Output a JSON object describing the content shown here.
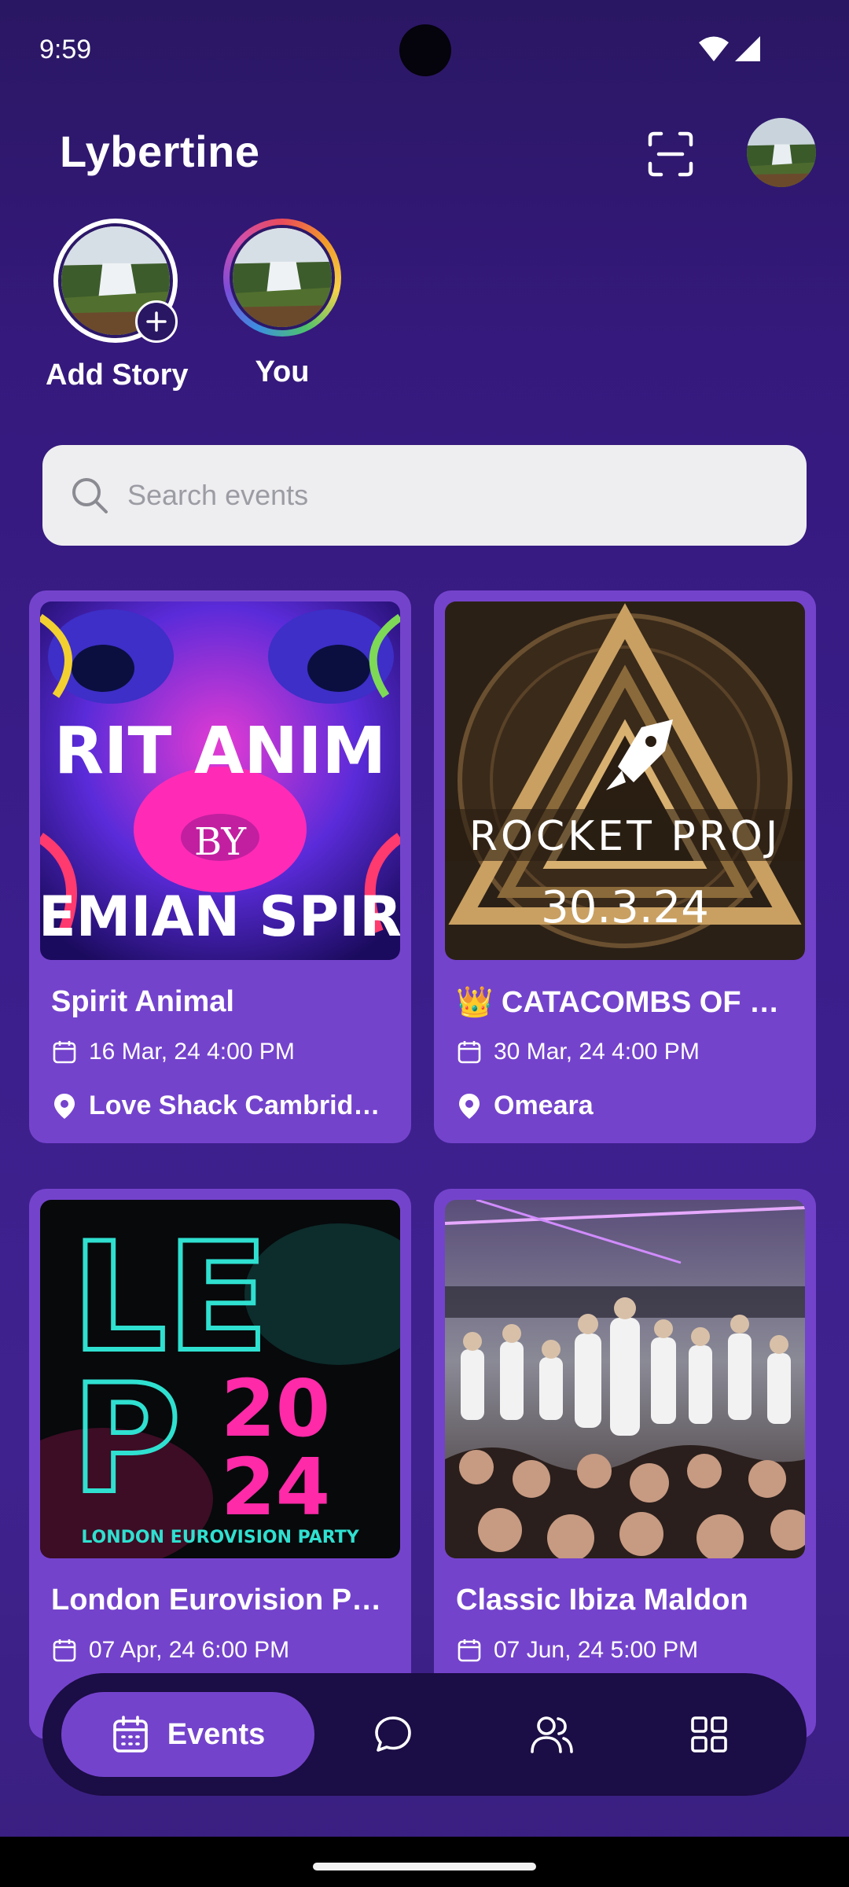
{
  "status_bar": {
    "time": "9:59"
  },
  "header": {
    "app_title": "Lybertine"
  },
  "stories": [
    {
      "label": "Add Story"
    },
    {
      "label": "You"
    }
  ],
  "search": {
    "placeholder": "Search events",
    "value": ""
  },
  "events": [
    {
      "title": "Spirit Animal",
      "date": "16 Mar, 24 4:00 PM",
      "venue": "Love Shack Cambridge...",
      "poster_text": [
        "RIT ANIM",
        "BY",
        "EMIAN SPIR"
      ]
    },
    {
      "title": "👑 CATACOMBS OF C...",
      "date": "30 Mar, 24 4:00 PM",
      "venue": "Omeara",
      "poster_text": [
        "ROCKET PROJ",
        "30.3.24"
      ]
    },
    {
      "title": "London Eurovision Pa...",
      "date": "07 Apr, 24 6:00 PM",
      "poster_text": [
        "LE",
        "P",
        "20",
        "24",
        "LONDON EUROVISION PARTY"
      ]
    },
    {
      "title": "Classic Ibiza Maldon",
      "date": "07 Jun, 24 5:00 PM"
    }
  ],
  "bottom_nav": {
    "active_label": "Events",
    "items": [
      "events-icon",
      "chat-icon",
      "people-icon",
      "grid-icon"
    ]
  },
  "colors": {
    "background": "#35197c",
    "card": "#7443cc",
    "nav_bar": "#1b0d45",
    "active_tab": "#7443cc",
    "search_bg": "#eeeef0"
  }
}
